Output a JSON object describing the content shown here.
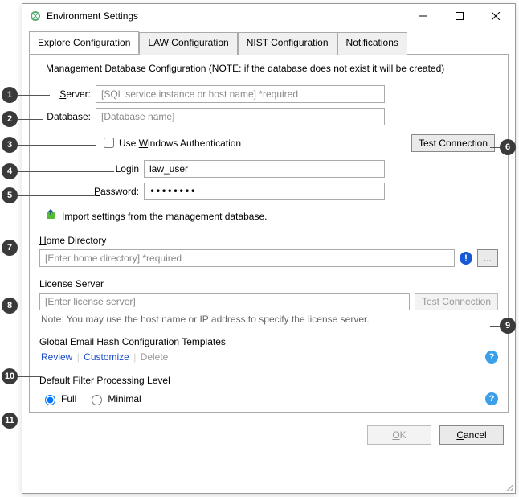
{
  "window": {
    "title": "Environment Settings"
  },
  "tabs": {
    "explore": "Explore Configuration",
    "law": "LAW Configuration",
    "nist": "NIST Configuration",
    "notifications": "Notifications"
  },
  "db": {
    "heading": "Management Database Configuration (NOTE: if the database does not exist it will be created)",
    "server_label": "Server:",
    "server_placeholder": "[SQL service instance or host name] *required",
    "database_label": "Database:",
    "database_placeholder": "[Database name]",
    "winauth_pre": "Use ",
    "winauth_accel": "W",
    "winauth_post": "indows Authentication",
    "login_label": "Login",
    "login_value": "law_user",
    "password_pre": "",
    "password_accel": "P",
    "password_post": "assword:",
    "password_value": "••••••••",
    "test_btn": "Test Connection",
    "import_text": "Import settings from the management database."
  },
  "home": {
    "label_accel": "H",
    "label_post": "ome Directory",
    "placeholder": "[Enter home directory] *required",
    "browse": "..."
  },
  "lic": {
    "label": "License Server",
    "placeholder": "[Enter license server]",
    "test_btn": "Test Connection",
    "note": "Note: You may use the host name or IP address to specify the license server."
  },
  "hash": {
    "label": "Global Email Hash Configuration Templates",
    "review": "Review",
    "customize": "Customize",
    "delete": "Delete"
  },
  "filter": {
    "label": "Default Filter Processing Level",
    "full": "Full",
    "minimal": "Minimal"
  },
  "dialog": {
    "ok_accel": "O",
    "ok_post": "K",
    "cancel_accel": "C",
    "cancel_post": "ancel"
  },
  "callouts": {
    "1": "1",
    "2": "2",
    "3": "3",
    "4": "4",
    "5": "5",
    "6": "6",
    "7": "7",
    "8": "8",
    "9": "9",
    "10": "10",
    "11": "11"
  }
}
